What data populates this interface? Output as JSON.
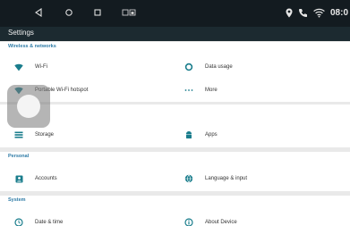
{
  "status_bar": {
    "time": "08:0",
    "nav_icons": [
      "back-icon",
      "home-icon",
      "recents-icon",
      "screenshot-icon"
    ],
    "status_icons": [
      "location-icon",
      "phone-icon",
      "wifi-icon"
    ]
  },
  "app_bar": {
    "title": "Settings"
  },
  "sections": {
    "wireless": {
      "header": "Wireless & networks",
      "wifi": "Wi-Fi",
      "data_usage": "Data usage",
      "hotspot": "Portable Wi-Fi hotspot",
      "more": "More"
    },
    "device": {
      "storage": "Storage",
      "apps": "Apps"
    },
    "personal": {
      "header": "Personal",
      "accounts": "Accounts",
      "language": "Language & input"
    },
    "system": {
      "header": "System",
      "date_time": "Date & time",
      "about": "About Device"
    }
  },
  "colors": {
    "status_bar": "#131b20",
    "app_bar": "#1c2a30",
    "section_header_text": "#2e7ba6",
    "icon_accent": "#1a7d8c"
  }
}
